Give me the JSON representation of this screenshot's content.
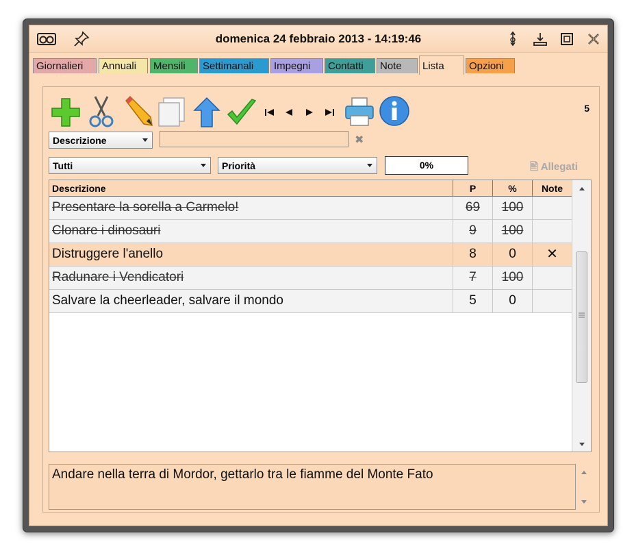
{
  "window": {
    "title": "domenica 24 febbraio 2013 - 14:19:46"
  },
  "tabs": [
    {
      "label": "Giornalieri",
      "color": "#e5a8a8"
    },
    {
      "label": "Annuali",
      "color": "#f3e6a6"
    },
    {
      "label": "Mensili",
      "color": "#4fb56a"
    },
    {
      "label": "Settimanali",
      "color": "#2a9bd0"
    },
    {
      "label": "Impegni",
      "color": "#a8a0e0"
    },
    {
      "label": "Contatti",
      "color": "#3f9e98"
    },
    {
      "label": "Note",
      "color": "#b8b8b8"
    },
    {
      "label": "Lista",
      "color": "#fddcbe",
      "active": true
    },
    {
      "label": "Opzioni",
      "color": "#f7a04a"
    }
  ],
  "toolbar": {
    "icons": [
      "add-icon",
      "cut-icon",
      "edit-pencil-icon",
      "copy-icon",
      "move-up-icon",
      "check-done-icon",
      "first-icon",
      "previous-icon",
      "next-icon",
      "last-icon",
      "print-icon",
      "info-icon"
    ],
    "count": "5"
  },
  "filters": {
    "field_select": "Descrizione",
    "search_value": "",
    "status_select": "Tutti",
    "priority_select": "Priorità",
    "progress": "0%",
    "attachments_label": "Allegati"
  },
  "table": {
    "headers": {
      "description": "Descrizione",
      "priority": "P",
      "percent": "%",
      "note": "Note"
    },
    "rows": [
      {
        "description": "Presentare la sorella a Carmelo!",
        "priority": "69",
        "percent": "100",
        "note": "",
        "done": true
      },
      {
        "description": "Clonare i dinosauri",
        "priority": "9",
        "percent": "100",
        "note": "",
        "done": true
      },
      {
        "description": "Distruggere l'anello",
        "priority": "8",
        "percent": "0",
        "note": "✕",
        "done": false,
        "selected": true
      },
      {
        "description": "Radunare i Vendicatori",
        "priority": "7",
        "percent": "100",
        "note": "",
        "done": true
      },
      {
        "description": "Salvare la cheerleader, salvare il mondo",
        "priority": "5",
        "percent": "0",
        "note": "",
        "done": false
      }
    ]
  },
  "detail": {
    "text": "Andare nella terra di Mordor, gettarlo tra le fiamme del Monte Fato"
  },
  "colors": {
    "background": "#fddcbe",
    "row_selected": "#fbd9b8",
    "row_default": "#f3f3f3"
  }
}
